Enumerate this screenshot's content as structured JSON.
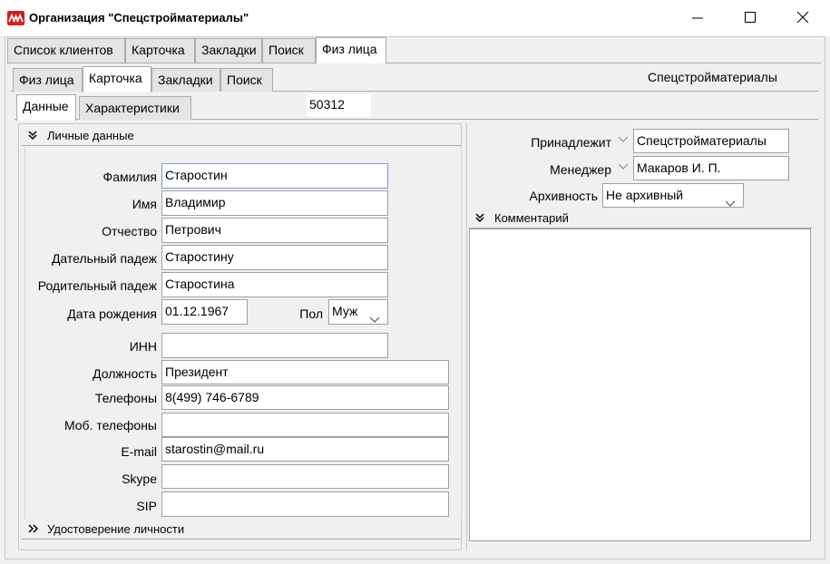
{
  "window": {
    "title": "Организация \"Спецстройматериалы\""
  },
  "top_tabs": [
    {
      "label": "Список клиентов"
    },
    {
      "label": "Карточка"
    },
    {
      "label": "Закладки"
    },
    {
      "label": "Поиск"
    },
    {
      "label": "Физ лица",
      "active": true
    }
  ],
  "sub_tabs": [
    {
      "label": "Физ лица"
    },
    {
      "label": "Карточка",
      "active": true
    },
    {
      "label": "Закладки"
    },
    {
      "label": "Поиск"
    }
  ],
  "org_name": "Спецстройматериалы",
  "inner_tabs": [
    {
      "label": "Данные",
      "active": true
    },
    {
      "label": "Характеристики"
    }
  ],
  "record_id": "50312",
  "personal": {
    "section_title": "Личные данные",
    "surname_label": "Фамилия",
    "surname": "Старостин",
    "name_label": "Имя",
    "name": "Владимир",
    "patronymic_label": "Отчество",
    "patronymic": "Петрович",
    "dative_label": "Дательный падеж",
    "dative": "Старостину",
    "genitive_label": "Родительный падеж",
    "genitive": "Старостина",
    "birthdate_label": "Дата рождения",
    "birthdate": "01.12.1967",
    "gender_label": "Пол",
    "gender": "Муж",
    "inn_label": "ИНН",
    "inn": "",
    "position_label": "Должность",
    "position": "Президент",
    "phones_label": "Телефоны",
    "phones": "8(499) 746-6789",
    "mobile_label": "Моб. телефоны",
    "mobile": "",
    "email_label": "E-mail",
    "email": "starostin@mail.ru",
    "skype_label": "Skype",
    "skype": "",
    "sip_label": "SIP",
    "sip": ""
  },
  "id_section_title": "Удостоверение личности",
  "right": {
    "belongs_label": "Принадлежит",
    "belongs": "Спецстройматериалы",
    "manager_label": "Менеджер",
    "manager": "Макаров И. П.",
    "archive_label": "Архивность",
    "archive": "Не архивный",
    "comment_title": "Комментарий",
    "comment": ""
  },
  "icons": {
    "app": "app-logo-icon",
    "minimize": "minimize-icon",
    "maximize": "maximize-icon",
    "close": "close-icon",
    "collapse": "chevron-double-down-icon",
    "expand": "chevron-double-right-icon",
    "dropdown": "chevron-down-icon"
  },
  "colors": {
    "app_icon": "#d91b1b",
    "focus_border": "#7a9cc6"
  }
}
